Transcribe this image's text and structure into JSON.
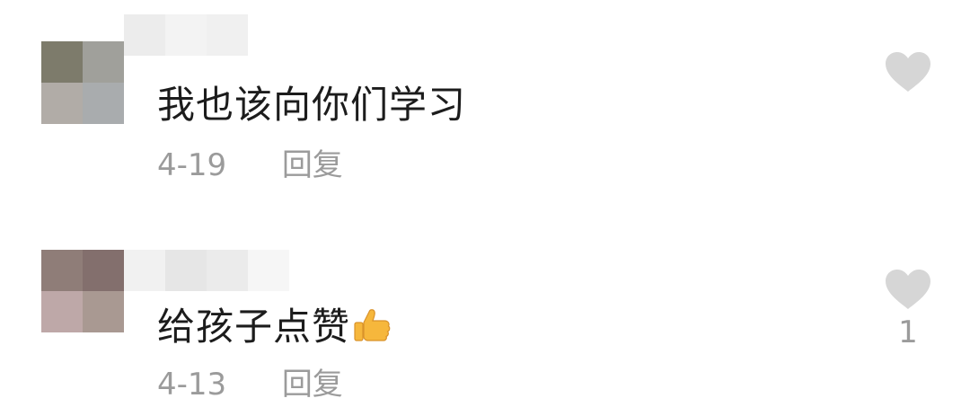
{
  "comments": [
    {
      "avatar_pixels": [
        "#7d7b6b",
        "#a0a09b",
        "#b1aca7",
        "#a9acae"
      ],
      "name_mosaic": [
        "#ececec",
        "#f3f3f3",
        "#f0f0f0"
      ],
      "text": "我也该向你们学习",
      "emoji": "",
      "date": "4-19",
      "reply_label": "回复",
      "like_icon": "heart-icon",
      "like_count": ""
    },
    {
      "avatar_pixels": [
        "#8f7d78",
        "#836f6d",
        "#bea8a8",
        "#a99992"
      ],
      "name_mosaic": [
        "#f1f1f1",
        "#e6e6e6",
        "#ebebeb",
        "#f6f6f6"
      ],
      "text": "给孩子点赞",
      "emoji": "thumbs-up-emoji",
      "date": "4-13",
      "reply_label": "回复",
      "like_icon": "heart-icon",
      "like_count": "1"
    }
  ],
  "colors": {
    "text": "#1c1c1c",
    "meta": "#9b9b9b",
    "heart": "#d6d6d6",
    "thumb": "#f6b73c"
  }
}
